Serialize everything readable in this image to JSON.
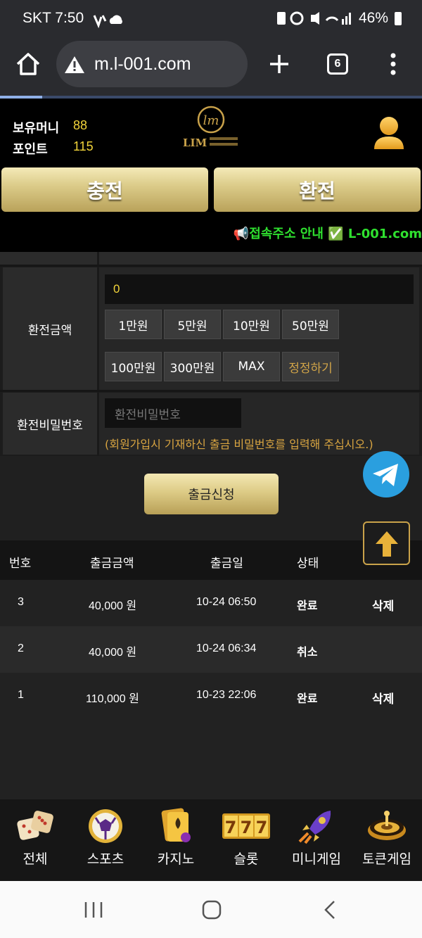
{
  "status_bar": {
    "carrier_time": "SKT 7:50",
    "battery": "46%"
  },
  "browser": {
    "url": "m.l-001.com",
    "tab_count": "6"
  },
  "header": {
    "money_label": "보유머니",
    "money_value": "88",
    "point_label": "포인트",
    "point_value": "115",
    "logo_text": "LIM"
  },
  "actions": {
    "charge": "충전",
    "exchange": "환전"
  },
  "notice": {
    "text": "📢접속주소 안내 ✅ L-001.com"
  },
  "form": {
    "amount_label": "환전금액",
    "amount_value": "0",
    "amount_buttons": [
      "1만원",
      "5만원",
      "10만원",
      "50만원",
      "100만원",
      "300만원",
      "MAX",
      "정정하기"
    ],
    "password_label": "환전비밀번호",
    "password_placeholder": "환전비밀번호",
    "hint": "(회원가입시 기재하신 출금 비밀번호를 입력해 주십시오.)",
    "submit": "출금신청"
  },
  "table": {
    "headers": [
      "번호",
      "출금금액",
      "출금일",
      "상태"
    ],
    "rows": [
      {
        "no": "3",
        "amount": "40,000 원",
        "date": "10-24 06:50",
        "status": "완료",
        "action": "삭제"
      },
      {
        "no": "2",
        "amount": "40,000 원",
        "date": "10-24 06:34",
        "status": "취소",
        "action": ""
      },
      {
        "no": "1",
        "amount": "110,000 원",
        "date": "10-23 22:06",
        "status": "완료",
        "action": "삭제"
      }
    ]
  },
  "bottom_nav": [
    {
      "label": "전체",
      "icon": "dice-icon"
    },
    {
      "label": "스포츠",
      "icon": "soccer-ball-icon"
    },
    {
      "label": "카지노",
      "icon": "cards-icon"
    },
    {
      "label": "슬롯",
      "icon": "slot-777-icon"
    },
    {
      "label": "미니게임",
      "icon": "rocket-icon"
    },
    {
      "label": "토큰게임",
      "icon": "roulette-icon"
    }
  ],
  "colors": {
    "gold": "#dccc8a",
    "accent_yellow": "#f2d43a",
    "notice_green": "#2fe02f",
    "hint_orange": "#d9a541"
  }
}
